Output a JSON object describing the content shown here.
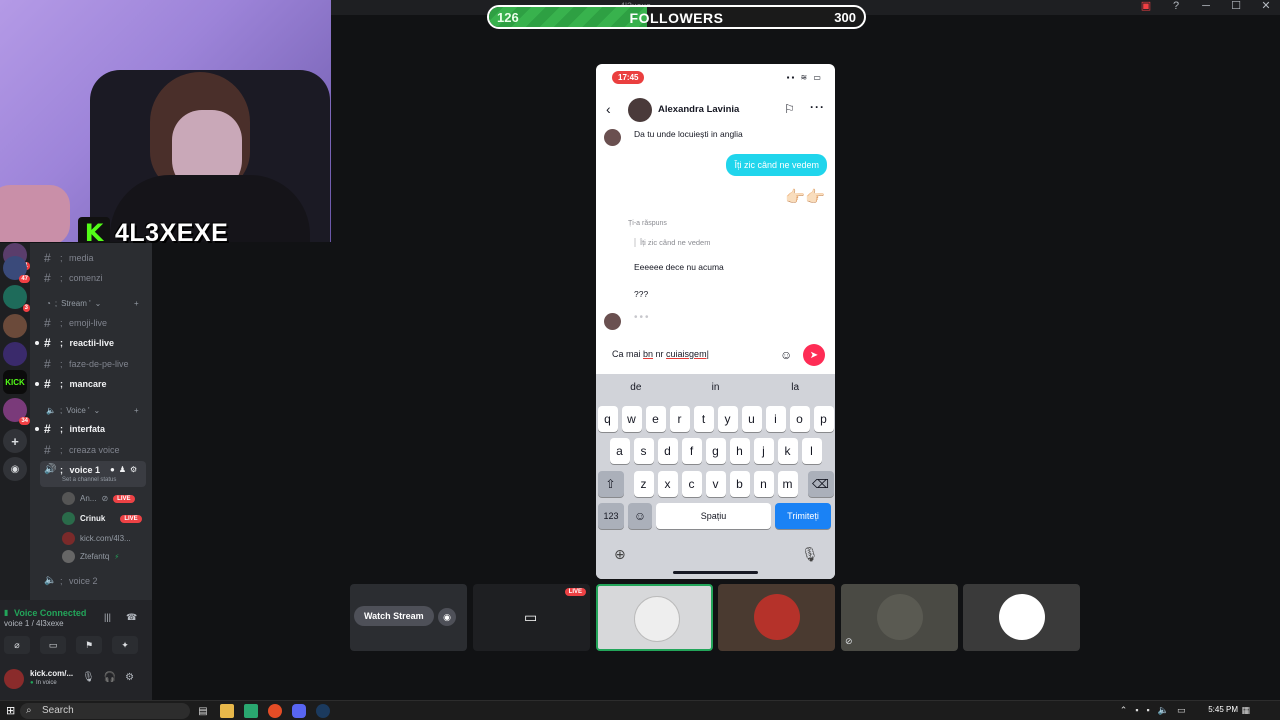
{
  "window": {
    "title": "4l3xexe"
  },
  "followers": {
    "current": "126",
    "label": "FOLLOWERS",
    "goal": "300",
    "progress_fraction": 0.42
  },
  "streamer": {
    "name": "4L3XEXE",
    "brand_color": "#53fc18"
  },
  "guilds": [
    {
      "icon": "server-icon",
      "badge": "1"
    },
    {
      "icon": "server-icon",
      "badge": "47"
    },
    {
      "icon": "server-icon",
      "badge": "3"
    },
    {
      "icon": "server-icon",
      "badge": ""
    },
    {
      "icon": "server-icon",
      "badge": ""
    },
    {
      "icon": "kick-server-icon",
      "label": "KICK",
      "badge": ""
    },
    {
      "icon": "server-icon",
      "badge": "34"
    }
  ],
  "channels": {
    "text_top": [
      {
        "name": "media"
      },
      {
        "name": "comenzi"
      }
    ],
    "stream_category": "Stream '",
    "stream_channels": [
      {
        "name": "emoji-live"
      },
      {
        "name": "reactii-live",
        "unread": true
      },
      {
        "name": "faze-de-pe-live"
      },
      {
        "name": "mancare",
        "unread": true
      }
    ],
    "voice_category": "Voice '",
    "voice_channels": [
      {
        "name": "interfata",
        "unread": true
      },
      {
        "name": "creaza voice"
      },
      {
        "name": "voice 1",
        "selected": true,
        "status": "Set a channel status"
      }
    ],
    "voice_users": [
      {
        "name": "An...",
        "live": "LIVE"
      },
      {
        "name": "Crinuk",
        "live": "LIVE"
      },
      {
        "name": "kick.com/4l3...",
        "live": ""
      },
      {
        "name": "Ztefantq",
        "live": ""
      }
    ],
    "voice_2": "voice 2"
  },
  "voice_panel": {
    "title": "Voice Connected",
    "subtitle": "voice 1 / 4l3xexe"
  },
  "user": {
    "name": "kick.com/...",
    "status": "In voice"
  },
  "phone": {
    "time": "17:45",
    "contact": "Alexandra Lavinia",
    "messages": {
      "incoming_1": "Da tu unde locuiești in anglia",
      "outgoing_1": "Îți zic când ne vedem",
      "emoji": "👉🏻👉🏻",
      "reply_label": "Ți-a răspuns",
      "reply_quote": "Îți zic când ne vedem",
      "incoming_2": "Eeeeee dece nu acuma",
      "incoming_3": "???"
    },
    "input": {
      "text_before": "Ca mai ",
      "word_1": "bn",
      "text_mid": " nr ",
      "word_2": "cuiaisgem"
    },
    "suggestions": [
      "de",
      "in",
      "la"
    ],
    "keys_row1": [
      "q",
      "w",
      "e",
      "r",
      "t",
      "y",
      "u",
      "i",
      "o",
      "p"
    ],
    "keys_row2": [
      "a",
      "s",
      "d",
      "f",
      "g",
      "h",
      "j",
      "k",
      "l"
    ],
    "keys_row3": [
      "z",
      "x",
      "c",
      "v",
      "b",
      "n",
      "m"
    ],
    "key_num": "123",
    "key_space": "Spațiu",
    "key_send": "Trimiteți"
  },
  "tiles": {
    "watch_stream": "Watch Stream",
    "live": "LIVE"
  },
  "taskbar": {
    "search": "Search",
    "time": "5:45 PM"
  }
}
